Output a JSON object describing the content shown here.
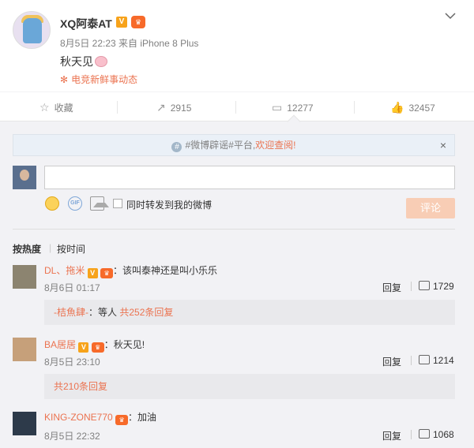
{
  "post": {
    "username": "XQ阿泰AT",
    "verified_badge": "V",
    "meta": "8月5日 22:23 来自 iPhone 8 Plus",
    "text": "秋天见",
    "topic_link": "电竞新鲜事动态"
  },
  "actions": {
    "favorite_label": "收藏",
    "repost_count": "2915",
    "comment_count": "12277",
    "like_count": "32457"
  },
  "notice": {
    "prefix": "#微博辟谣#平台,",
    "link": "欢迎查阅!",
    "close": "×"
  },
  "composer": {
    "input_value": "",
    "repost_checkbox_label": "同时转发到我的微博",
    "submit_label": "评论"
  },
  "sort": {
    "hot": "按热度",
    "time": "按时间"
  },
  "comments": [
    {
      "name": "DL、拖米",
      "text": "：该叫泰神还是叫小乐乐",
      "time": "8月6日 01:17",
      "reply_label": "回复",
      "likes": "1729",
      "sub_reply_author": "-桔魚肆-",
      "sub_reply_text": "：等人",
      "sub_reply_count": "共252条回复"
    },
    {
      "name": "BA居居",
      "text": "：秋天见!",
      "time": "8月5日 23:10",
      "reply_label": "回复",
      "likes": "1214",
      "sub_reply_count": "共210条回复"
    },
    {
      "name": "KING-ZONE770",
      "text": "：加油",
      "time": "8月5日 22:32",
      "reply_label": "回复",
      "likes": "1068"
    }
  ],
  "colors": {
    "accent_orange": "#eb7350",
    "background_gray": "#f2f2f5",
    "submit_disabled": "#f8cdb5"
  }
}
